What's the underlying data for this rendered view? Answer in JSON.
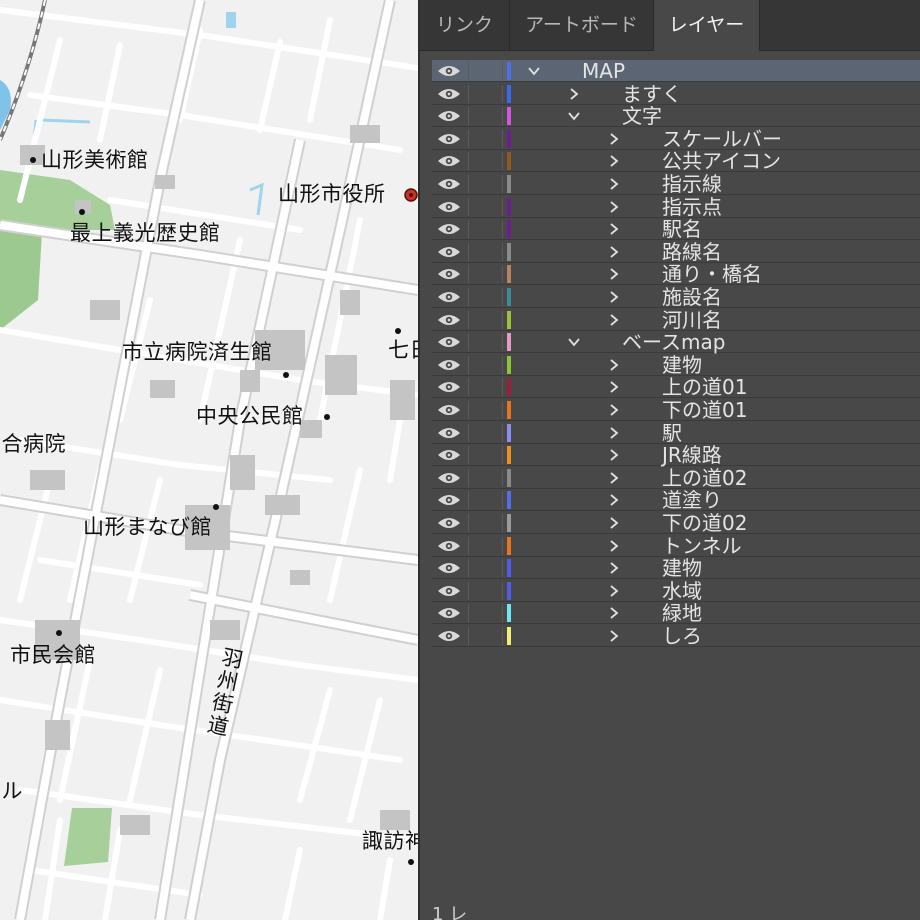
{
  "map": {
    "labels": [
      {
        "id": "museum",
        "text": "山形美術館"
      },
      {
        "id": "cityhall",
        "text": "山形市役所"
      },
      {
        "id": "history",
        "text": "最上義光歴史館"
      },
      {
        "id": "hospital",
        "text": "市立病院済生館"
      },
      {
        "id": "nana",
        "text": "七日"
      },
      {
        "id": "community",
        "text": "中央公民館"
      },
      {
        "id": "general",
        "text": "総合病院"
      },
      {
        "id": "manabi",
        "text": "山形まなび館"
      },
      {
        "id": "shimin",
        "text": "市民会館"
      },
      {
        "id": "ushu",
        "text": "羽州街道"
      },
      {
        "id": "biru",
        "text": "ビル"
      },
      {
        "id": "suwa",
        "text": "諏訪神"
      }
    ]
  },
  "panel": {
    "tabs": [
      {
        "label": "リンク",
        "active": false
      },
      {
        "label": "アートボード",
        "active": false
      },
      {
        "label": "レイヤー",
        "active": true
      }
    ],
    "layers": [
      {
        "name": "MAP",
        "level": 0,
        "expanded": true,
        "color": "#4f6ee8",
        "selected": true
      },
      {
        "name": "ますく",
        "level": 1,
        "expanded": false,
        "color": "#3a6be8"
      },
      {
        "name": "文字",
        "level": 1,
        "expanded": true,
        "color": "#d257e0"
      },
      {
        "name": "スケールバー",
        "level": 2,
        "expanded": false,
        "color": "#6a1f8c"
      },
      {
        "name": "公共アイコン",
        "level": 2,
        "expanded": false,
        "color": "#8f5a1c"
      },
      {
        "name": "指示線",
        "level": 2,
        "expanded": false,
        "color": "#8a8a8a"
      },
      {
        "name": "指示点",
        "level": 2,
        "expanded": false,
        "color": "#6a1f8c"
      },
      {
        "name": "駅名",
        "level": 2,
        "expanded": false,
        "color": "#6a1f8c"
      },
      {
        "name": "路線名",
        "level": 2,
        "expanded": false,
        "color": "#8a8a8a"
      },
      {
        "name": "通り・橋名",
        "level": 2,
        "expanded": false,
        "color": "#b7845f"
      },
      {
        "name": "施設名",
        "level": 2,
        "expanded": false,
        "color": "#3c8c95"
      },
      {
        "name": "河川名",
        "level": 2,
        "expanded": false,
        "color": "#9ac436"
      },
      {
        "name": "ベースmap",
        "level": 1,
        "expanded": true,
        "color": "#e89ac6"
      },
      {
        "name": "建物",
        "level": 2,
        "expanded": false,
        "color": "#8dc436"
      },
      {
        "name": "上の道01",
        "level": 2,
        "expanded": false,
        "color": "#9c1f3a"
      },
      {
        "name": "下の道01",
        "level": 2,
        "expanded": false,
        "color": "#e8741f"
      },
      {
        "name": "駅",
        "level": 2,
        "expanded": false,
        "color": "#8f8cf2"
      },
      {
        "name": "JR線路",
        "level": 2,
        "expanded": false,
        "color": "#e8921f"
      },
      {
        "name": "上の道02",
        "level": 2,
        "expanded": false,
        "color": "#8a8a8a"
      },
      {
        "name": "道塗り",
        "level": 2,
        "expanded": false,
        "color": "#4f6ee8"
      },
      {
        "name": "下の道02",
        "level": 2,
        "expanded": false,
        "color": "#9a9a9a"
      },
      {
        "name": "トンネル",
        "level": 2,
        "expanded": false,
        "color": "#e8741f"
      },
      {
        "name": "建物",
        "level": 2,
        "expanded": false,
        "color": "#4f5de8"
      },
      {
        "name": "水域",
        "level": 2,
        "expanded": false,
        "color": "#4f5de8"
      },
      {
        "name": "緑地",
        "level": 2,
        "expanded": false,
        "color": "#6ee8f2"
      },
      {
        "name": "しろ",
        "level": 2,
        "expanded": false,
        "color": "#f2ee6e"
      }
    ],
    "footer": {
      "count_text": "1 レ"
    }
  }
}
